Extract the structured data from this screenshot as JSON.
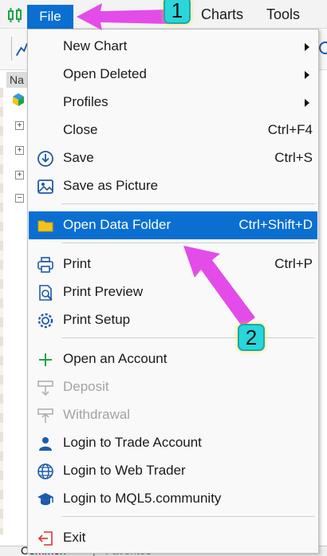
{
  "menubar": {
    "file_label": "File",
    "items": [
      "Charts",
      "Tools"
    ]
  },
  "navigator": {
    "header_label": "Na"
  },
  "file_menu": {
    "items": [
      {
        "label": "New Chart",
        "shortcut": "",
        "submenu": true,
        "icon": "",
        "disabled": false
      },
      {
        "label": "Open Deleted",
        "shortcut": "",
        "submenu": true,
        "icon": "",
        "disabled": false
      },
      {
        "label": "Profiles",
        "shortcut": "",
        "submenu": true,
        "icon": "",
        "disabled": false
      },
      {
        "label": "Close",
        "shortcut": "Ctrl+F4",
        "submenu": false,
        "icon": "",
        "disabled": false
      },
      {
        "label": "Save",
        "shortcut": "Ctrl+S",
        "submenu": false,
        "icon": "save-circle-icon",
        "disabled": false
      },
      {
        "label": "Save as Picture",
        "shortcut": "",
        "submenu": false,
        "icon": "picture-icon",
        "disabled": false
      },
      {
        "label": "Open Data Folder",
        "shortcut": "Ctrl+Shift+D",
        "submenu": false,
        "icon": "folder-icon",
        "disabled": false,
        "highlighted": true
      },
      {
        "label": "Print",
        "shortcut": "Ctrl+P",
        "submenu": false,
        "icon": "printer-icon",
        "disabled": false
      },
      {
        "label": "Print Preview",
        "shortcut": "",
        "submenu": false,
        "icon": "print-preview-icon",
        "disabled": false
      },
      {
        "label": "Print Setup",
        "shortcut": "",
        "submenu": false,
        "icon": "print-setup-icon",
        "disabled": false
      },
      {
        "label": "Open an Account",
        "shortcut": "",
        "submenu": false,
        "icon": "plus-icon",
        "disabled": false
      },
      {
        "label": "Deposit",
        "shortcut": "",
        "submenu": false,
        "icon": "deposit-icon",
        "disabled": true
      },
      {
        "label": "Withdrawal",
        "shortcut": "",
        "submenu": false,
        "icon": "withdrawal-icon",
        "disabled": true
      },
      {
        "label": "Login to Trade Account",
        "shortcut": "",
        "submenu": false,
        "icon": "user-icon",
        "disabled": false
      },
      {
        "label": "Login to Web Trader",
        "shortcut": "",
        "submenu": false,
        "icon": "globe-icon",
        "disabled": false
      },
      {
        "label": "Login to MQL5.community",
        "shortcut": "",
        "submenu": false,
        "icon": "graduation-cap-icon",
        "disabled": false
      },
      {
        "label": "Exit",
        "shortcut": "",
        "submenu": false,
        "icon": "exit-icon",
        "disabled": false
      }
    ]
  },
  "annotations": {
    "step1": "1",
    "step2": "2"
  },
  "bottom_tabs": {
    "common": "Common",
    "separator": "|",
    "favorites": "Favorites"
  },
  "colors": {
    "highlight": "#0a6fd1",
    "badge": "#2ad6da",
    "arrow": "#e34ce8",
    "folder": "#f5c21b",
    "accent_icon": "#1e5aa8",
    "green_plus": "#1fa34a",
    "exit_red": "#d9352f"
  }
}
